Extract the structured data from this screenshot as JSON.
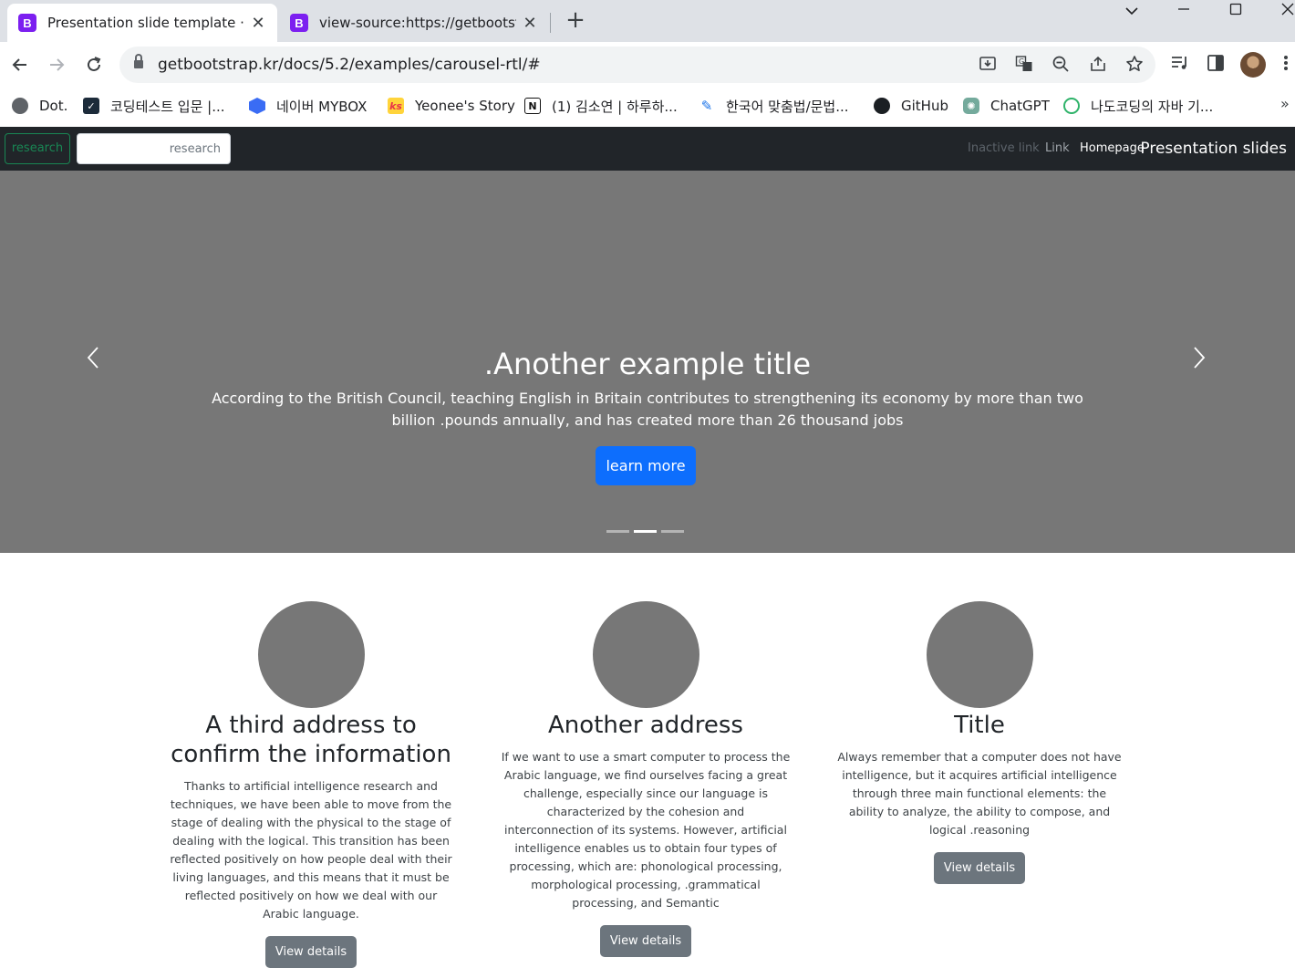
{
  "browser": {
    "tabs": [
      {
        "title": "Presentation slide template · Bo",
        "active": true
      },
      {
        "title": "view-source:https://getbootstrap",
        "active": false
      }
    ],
    "url": "getbootstrap.kr/docs/5.2/examples/carousel-rtl/#",
    "bookmarks": [
      {
        "label": "Dot."
      },
      {
        "label": "코딩테스트 입문 |..."
      },
      {
        "label": "네이버 MYBOX"
      },
      {
        "label": "Yeonee's Story"
      },
      {
        "label": "(1) 김소연 | 하루하..."
      },
      {
        "label": "한국어 맞춤법/문법..."
      },
      {
        "label": "GitHub"
      },
      {
        "label": "ChatGPT"
      },
      {
        "label": "나도코딩의 자바 기..."
      }
    ],
    "bookmarks_more": "»"
  },
  "navbar": {
    "search_button": "research",
    "search_placeholder": "research",
    "links": {
      "disabled": "Inactive link",
      "link": "Link",
      "home": "Homepage"
    },
    "brand": "Presentation slides"
  },
  "carousel": {
    "title": ".Another example title",
    "text": "According to the British Council, teaching English in Britain contributes to strengthening its economy by more than two billion .pounds annually, and has created more than 26 thousand jobs",
    "button": "learn more",
    "active_index": 1,
    "slide_count": 3
  },
  "columns": [
    {
      "heading": "A third address to confirm the information",
      "text": "Thanks to artificial intelligence research and techniques, we have been able to move from the stage of dealing with the physical to the stage of dealing with the logical. This transition has been reflected positively on how people deal with their living languages, and this means that it must be reflected positively on how we deal with our Arabic language.",
      "button": "View details"
    },
    {
      "heading": "Another address",
      "text": "If we want to use a smart computer to process the Arabic language, we find ourselves facing a great challenge, especially since our language is characterized by the cohesion and interconnection of its systems. However, artificial intelligence enables us to obtain four types of processing, which are: phonological processing, morphological processing, .grammatical processing, and Semantic",
      "button": "View details"
    },
    {
      "heading": "Title",
      "text": "Always remember that a computer does not have intelligence, but it acquires artificial intelligence through three main functional elements: the ability to analyze, the ability to compose, and logical .reasoning",
      "button": "View details"
    }
  ]
}
